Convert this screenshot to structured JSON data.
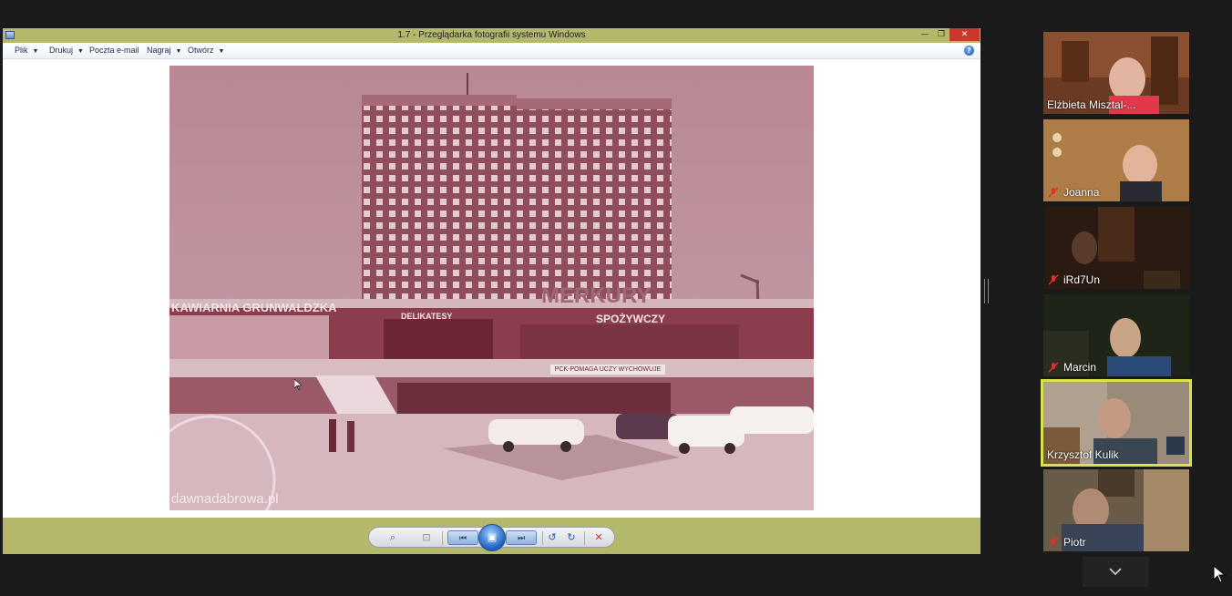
{
  "viewer": {
    "title": "1.7 - Przeglądarka fotografii systemu Windows",
    "minimize_glyph": "—",
    "maximize_glyph": "❐",
    "close_glyph": "✕",
    "menu": [
      {
        "label": "Plik"
      },
      {
        "label": "Drukuj"
      },
      {
        "label": "Poczta e-mail"
      },
      {
        "label": "Nagraj"
      },
      {
        "label": "Otwórz"
      }
    ],
    "help_glyph": "?",
    "photo": {
      "watermark": "dawnadabrowa.pl",
      "sign_top_left": "KAWIARNIA GRUNWALDZKA",
      "sign_delikatesy": "DELIKATESY",
      "sign_spozywczy": "SPOŻYWCZY",
      "sign_merkury": "MERKURY",
      "sign_pck": "PCK-POMAGA UCZY WYCHOWUJE"
    },
    "controls": {
      "zoom_glyph": "⌕",
      "fit_glyph": "⊡",
      "prev_glyph": "⏮",
      "slideshow_glyph": "▣",
      "next_glyph": "⏭",
      "rotate_left_glyph": "↺",
      "rotate_right_glyph": "↻",
      "delete_glyph": "✕"
    }
  },
  "gallery": {
    "participants": [
      {
        "name": "Elżbieta Misztal-...",
        "muted": false,
        "active": false
      },
      {
        "name": "Joanna",
        "muted": true,
        "active": false
      },
      {
        "name": "iRd7Un",
        "muted": true,
        "active": false
      },
      {
        "name": "Marcin",
        "muted": true,
        "active": false
      },
      {
        "name": "Krzysztof Kulik",
        "muted": false,
        "active": true
      },
      {
        "name": "Piotr",
        "muted": true,
        "active": false
      }
    ],
    "chevron_glyph": "⌄"
  },
  "colors": {
    "title_bar": "#b3b86a",
    "active_speaker": "#d8e24a",
    "mute_red": "#e0302a",
    "photo_tint": "#b98a94"
  }
}
